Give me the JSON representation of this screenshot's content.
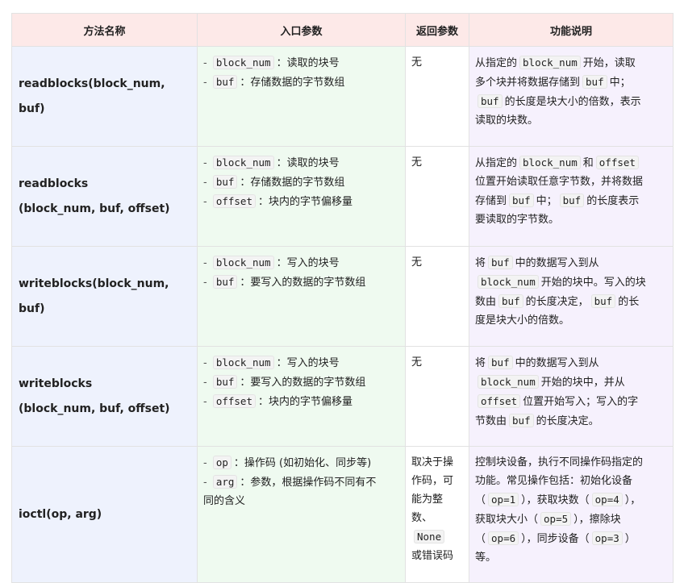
{
  "headers": [
    "方法名称",
    "入口参数",
    "返回参数",
    "功能说明"
  ],
  "rows": [
    {
      "name_lines": [
        "readblocks(block_num, buf)"
      ],
      "params": [
        [
          {
            "t": "- "
          },
          {
            "c": "block_num"
          },
          {
            "t": "：读取的块号"
          }
        ],
        [
          {
            "t": "- "
          },
          {
            "c": "buf"
          },
          {
            "t": "：存储数据的字节数组"
          }
        ]
      ],
      "ret": [
        [
          {
            "t": "无"
          }
        ]
      ],
      "desc": [
        [
          {
            "t": "从指定的"
          },
          {
            "c": "block_num"
          },
          {
            "t": "开始，读取"
          }
        ],
        [
          {
            "t": "多个块并将数据存储到"
          },
          {
            "c": "buf"
          },
          {
            "t": "中；"
          }
        ],
        [
          {
            "c": "buf"
          },
          {
            "t": "的长度是块大小的倍数，表示"
          }
        ],
        [
          {
            "t": "读取的块数。"
          }
        ]
      ]
    },
    {
      "name_lines": [
        "readblocks",
        "(block_num, buf, offset)"
      ],
      "params": [
        [
          {
            "t": "- "
          },
          {
            "c": "block_num"
          },
          {
            "t": "：读取的块号"
          }
        ],
        [
          {
            "t": "- "
          },
          {
            "c": "buf"
          },
          {
            "t": "：存储数据的字节数组"
          }
        ],
        [
          {
            "t": "- "
          },
          {
            "c": "offset"
          },
          {
            "t": "：块内的字节偏移量"
          }
        ]
      ],
      "ret": [
        [
          {
            "t": "无"
          }
        ]
      ],
      "desc": [
        [
          {
            "t": "从指定的"
          },
          {
            "c": "block_num"
          },
          {
            "t": "和"
          },
          {
            "c": "offset"
          }
        ],
        [
          {
            "t": "位置开始读取任意字节数，并将数据"
          }
        ],
        [
          {
            "t": "存储到"
          },
          {
            "c": "buf"
          },
          {
            "t": "中；"
          },
          {
            "c": "buf"
          },
          {
            "t": "的长度表示"
          }
        ],
        [
          {
            "t": "要读取的字节数。"
          }
        ]
      ]
    },
    {
      "name_lines": [
        "writeblocks(block_num, buf)"
      ],
      "params": [
        [
          {
            "t": "- "
          },
          {
            "c": "block_num"
          },
          {
            "t": "：写入的块号"
          }
        ],
        [
          {
            "t": "- "
          },
          {
            "c": "buf"
          },
          {
            "t": "：要写入的数据的字节数组"
          }
        ]
      ],
      "ret": [
        [
          {
            "t": "无"
          }
        ]
      ],
      "desc": [
        [
          {
            "t": "将"
          },
          {
            "c": "buf"
          },
          {
            "t": "中的数据写入到从"
          }
        ],
        [
          {
            "c": "block_num"
          },
          {
            "t": "开始的块中。写入的块"
          }
        ],
        [
          {
            "t": "数由"
          },
          {
            "c": "buf"
          },
          {
            "t": "的长度决定，"
          },
          {
            "c": "buf"
          },
          {
            "t": "的长"
          }
        ],
        [
          {
            "t": "度是块大小的倍数。"
          }
        ]
      ]
    },
    {
      "name_lines": [
        "writeblocks",
        "(block_num, buf, offset)"
      ],
      "params": [
        [
          {
            "t": "- "
          },
          {
            "c": "block_num"
          },
          {
            "t": "：写入的块号"
          }
        ],
        [
          {
            "t": "- "
          },
          {
            "c": "buf"
          },
          {
            "t": "：要写入的数据的字节数组"
          }
        ],
        [
          {
            "t": "- "
          },
          {
            "c": "offset"
          },
          {
            "t": "：块内的字节偏移量"
          }
        ]
      ],
      "ret": [
        [
          {
            "t": "无"
          }
        ]
      ],
      "desc": [
        [
          {
            "t": "将"
          },
          {
            "c": "buf"
          },
          {
            "t": "中的数据写入到从"
          }
        ],
        [
          {
            "c": "block_num"
          },
          {
            "t": "开始的块中，并从"
          }
        ],
        [
          {
            "c": "offset"
          },
          {
            "t": "位置开始写入；写入的字"
          }
        ],
        [
          {
            "t": "节数由"
          },
          {
            "c": "buf"
          },
          {
            "t": "的长度决定。"
          }
        ]
      ]
    },
    {
      "name_lines": [
        "ioctl(op, arg)"
      ],
      "params": [
        [
          {
            "t": "- "
          },
          {
            "c": "op"
          },
          {
            "t": "：操作码 (如初始化、同步等)"
          }
        ],
        [
          {
            "t": "- "
          },
          {
            "c": "arg"
          },
          {
            "t": "：参数，根据操作码不同有不"
          }
        ],
        [
          {
            "t": "同的含义"
          }
        ]
      ],
      "ret": [
        [
          {
            "t": "取决于操"
          }
        ],
        [
          {
            "t": "作码，可"
          }
        ],
        [
          {
            "t": "能为整"
          }
        ],
        [
          {
            "t": "数、"
          }
        ],
        [
          {
            "c": "None"
          }
        ],
        [
          {
            "t": "或错误码"
          }
        ]
      ],
      "desc": [
        [
          {
            "t": "控制块设备，执行不同操作码指定的"
          }
        ],
        [
          {
            "t": "功能。常见操作包括：初始化设备"
          }
        ],
        [
          {
            "t": "（"
          },
          {
            "c": "op=1"
          },
          {
            "t": "），获取块数（"
          },
          {
            "c": "op=4"
          },
          {
            "t": "），"
          }
        ],
        [
          {
            "t": "获取块大小（"
          },
          {
            "c": "op=5"
          },
          {
            "t": "），擦除块"
          }
        ],
        [
          {
            "t": "（"
          },
          {
            "c": "op=6"
          },
          {
            "t": "），同步设备（"
          },
          {
            "c": "op=3"
          },
          {
            "t": "）"
          }
        ],
        [
          {
            "t": "等。"
          }
        ]
      ]
    }
  ]
}
